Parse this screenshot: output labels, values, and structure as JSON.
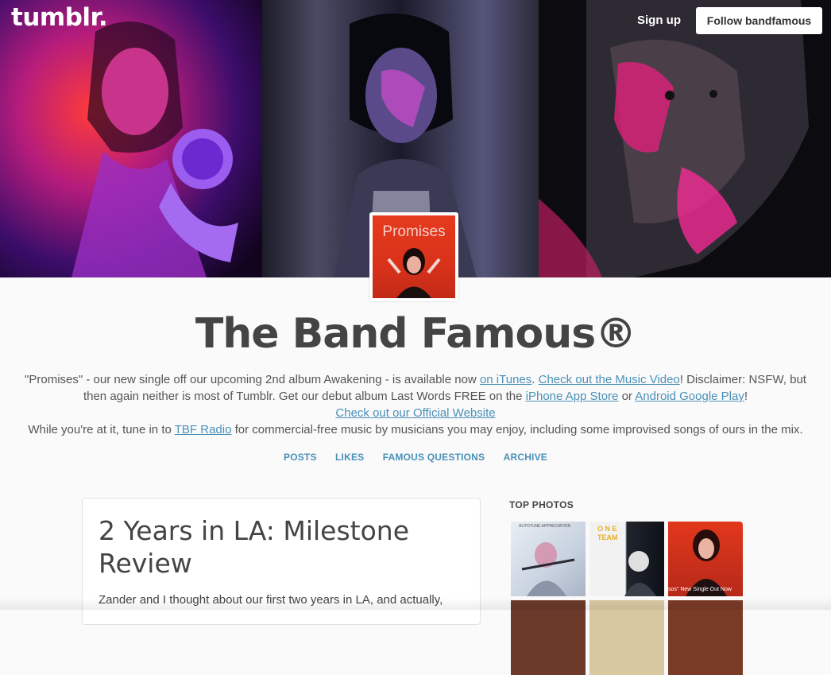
{
  "header": {
    "logo": "tumblr.",
    "signup_label": "Sign up",
    "follow_label": "Follow bandfamous"
  },
  "avatar": {
    "text": "Promises"
  },
  "blog": {
    "title": "The Band Famous®",
    "description": {
      "p1_text_a": "\"Promises\" - our new single off our upcoming 2nd album Awakening - is available now ",
      "p1_link_itunes": "on iTunes",
      "p1_text_b": ". ",
      "p1_link_video": "Check out the Music Video",
      "p1_text_c": "! Disclaimer: NSFW, but then again neither is most of Tumblr. Get our debut album Last Words FREE on the ",
      "p1_link_appstore": "iPhone App Store",
      "p1_text_d": " or ",
      "p1_link_play": "Android Google Play",
      "p1_text_e": "!",
      "link_website": "Check out our Official Website",
      "p3_text_a": "While you're at it, tune in to ",
      "p3_link_radio": "TBF Radio",
      "p3_text_b": " for commercial-free music by musicians you may enjoy, including some improvised songs of ours in the mix."
    }
  },
  "nav": {
    "posts": "POSTS",
    "likes": "LIKES",
    "famous_questions": "FAMOUS QUESTIONS",
    "archive": "ARCHIVE"
  },
  "post": {
    "title": "2 Years in LA: Milestone Review",
    "body_start": "Zander and I thought about our first two years in LA, and actually,"
  },
  "sidebar": {
    "top_photos_label": "TOP PHOTOS",
    "thumb_texts": {
      "t1": "AUTOTUNE APPRECIATION",
      "t2": "O N E TEAM",
      "t3": "sos\" New Single Out Now"
    }
  },
  "colors": {
    "link": "#4a90b8",
    "title": "#444444",
    "background": "#fafafa"
  }
}
